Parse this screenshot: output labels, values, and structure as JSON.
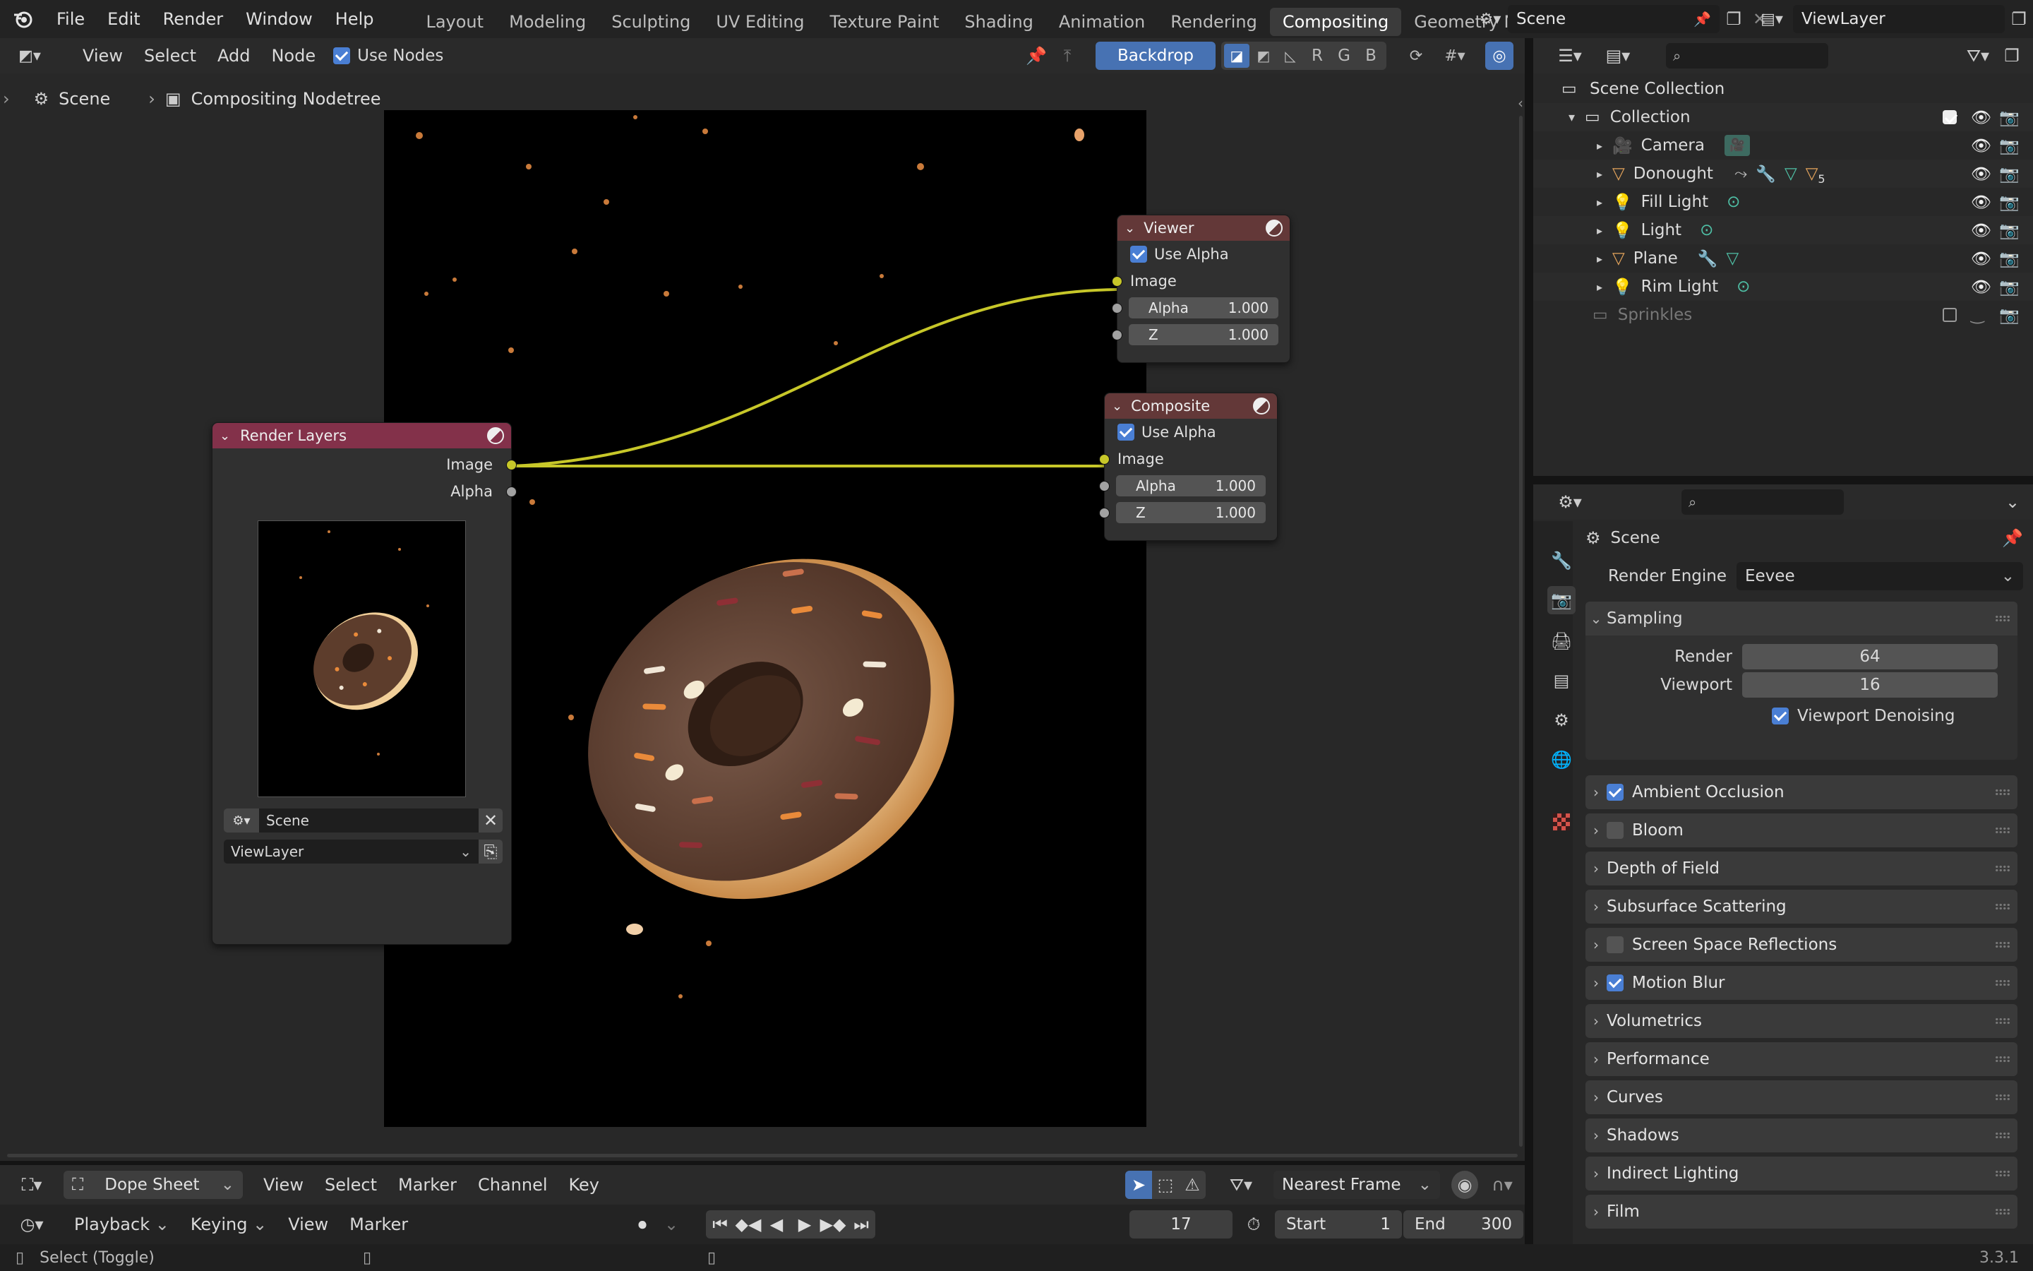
{
  "app": {
    "version": "3.3.1"
  },
  "menu": [
    "File",
    "Edit",
    "Render",
    "Window",
    "Help"
  ],
  "workspaces": [
    "Layout",
    "Modeling",
    "Sculpting",
    "UV Editing",
    "Texture Paint",
    "Shading",
    "Animation",
    "Rendering",
    "Compositing",
    "Geometry Nodes"
  ],
  "active_workspace": "Compositing",
  "scene_field": "Scene",
  "viewlayer_field": "ViewLayer",
  "node_editor": {
    "menus": [
      "View",
      "Select",
      "Add",
      "Node"
    ],
    "use_nodes_label": "Use Nodes",
    "backdrop_label": "Backdrop",
    "channel_buttons": [
      "R",
      "G",
      "B"
    ],
    "breadcrumb": {
      "scene": "Scene",
      "tree": "Compositing Nodetree"
    }
  },
  "nodes": {
    "render_layers": {
      "title": "Render Layers",
      "outputs": [
        "Image",
        "Alpha"
      ],
      "scene": "Scene",
      "layer": "ViewLayer"
    },
    "viewer": {
      "title": "Viewer",
      "use_alpha": "Use Alpha",
      "input_image": "Image",
      "alpha_label": "Alpha",
      "alpha_value": "1.000",
      "z_label": "Z",
      "z_value": "1.000"
    },
    "composite": {
      "title": "Composite",
      "use_alpha": "Use Alpha",
      "input_image": "Image",
      "alpha_label": "Alpha",
      "alpha_value": "1.000",
      "z_label": "Z",
      "z_value": "1.000"
    }
  },
  "outliner": {
    "root": "Scene Collection",
    "collection": "Collection",
    "items": [
      {
        "name": "Camera",
        "type": "camera"
      },
      {
        "name": "Donought",
        "type": "mesh",
        "badge": "5"
      },
      {
        "name": "Fill Light",
        "type": "light"
      },
      {
        "name": "Light",
        "type": "light"
      },
      {
        "name": "Plane",
        "type": "mesh"
      },
      {
        "name": "Rim Light",
        "type": "light"
      }
    ],
    "excluded": "Sprinkles"
  },
  "properties": {
    "title": "Scene",
    "render_engine_label": "Render Engine",
    "render_engine_value": "Eevee",
    "sampling": {
      "label": "Sampling",
      "render_label": "Render",
      "render_value": "64",
      "viewport_label": "Viewport",
      "viewport_value": "16",
      "denoise_label": "Viewport Denoising"
    },
    "panels": [
      {
        "label": "Ambient Occlusion",
        "checkbox": true,
        "checked": true
      },
      {
        "label": "Bloom",
        "checkbox": true,
        "checked": false
      },
      {
        "label": "Depth of Field",
        "checkbox": false
      },
      {
        "label": "Subsurface Scattering",
        "checkbox": false
      },
      {
        "label": "Screen Space Reflections",
        "checkbox": true,
        "checked": false
      },
      {
        "label": "Motion Blur",
        "checkbox": true,
        "checked": true
      },
      {
        "label": "Volumetrics",
        "checkbox": false
      },
      {
        "label": "Performance",
        "checkbox": false
      },
      {
        "label": "Curves",
        "checkbox": false
      },
      {
        "label": "Shadows",
        "checkbox": false
      },
      {
        "label": "Indirect Lighting",
        "checkbox": false
      },
      {
        "label": "Film",
        "checkbox": false
      }
    ]
  },
  "timeline": {
    "mode": "Dope Sheet",
    "menus": [
      "View",
      "Select",
      "Marker",
      "Channel",
      "Key"
    ],
    "snap": "Nearest Frame",
    "playback": "Playback",
    "keying": "Keying",
    "menus2": [
      "View",
      "Marker"
    ],
    "current_frame": "17",
    "start_label": "Start",
    "start_value": "1",
    "end_label": "End",
    "end_value": "300"
  },
  "status": {
    "hint": "Select (Toggle)"
  },
  "colors": {
    "accent": "#4772b3",
    "render_layer_header": "#83314a",
    "output_header": "#633838",
    "link": "#c7c729"
  }
}
